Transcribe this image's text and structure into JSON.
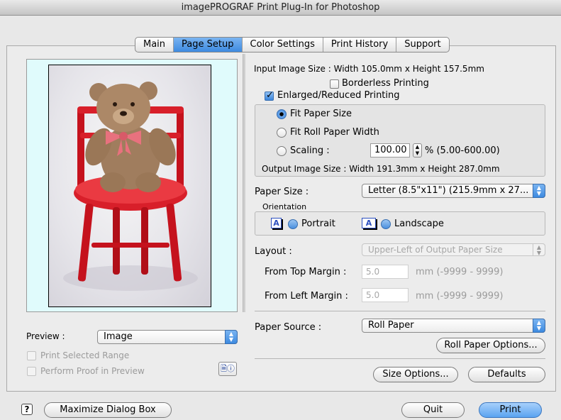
{
  "window": {
    "title": "imagePROGRAF Print Plug-In for Photoshop"
  },
  "tabs": [
    {
      "label": "Main",
      "active": false
    },
    {
      "label": "Page Setup",
      "active": true
    },
    {
      "label": "Color Settings",
      "active": false
    },
    {
      "label": "Print History",
      "active": false
    },
    {
      "label": "Support",
      "active": false
    }
  ],
  "page_setup": {
    "input_image_size": "Input Image Size : Width 105.0mm x Height 157.5mm",
    "borderless_printing": {
      "label": "Borderless Printing",
      "checked": false
    },
    "enlarged_reduced": {
      "label": "Enlarged/Reduced Printing",
      "checked": true
    },
    "fit_paper_size": {
      "label": "Fit Paper Size",
      "selected": true
    },
    "fit_roll_paper_width": {
      "label": "Fit Roll Paper Width",
      "selected": false
    },
    "scaling": {
      "label": "Scaling :",
      "selected": false,
      "value": "100.00",
      "range": "% (5.00-600.00)"
    },
    "output_image_size": "Output Image Size : Width 191.3mm x Height 287.0mm",
    "paper_size": {
      "label": "Paper Size :",
      "value": "Letter (8.5\"x11\") (215.9mm x 27..."
    },
    "orientation": {
      "label": "Orientation",
      "portrait": "Portrait",
      "landscape": "Landscape",
      "icon_glyph": "A"
    },
    "layout": {
      "label": "Layout :",
      "value": "Upper-Left of Output Paper Size"
    },
    "top_margin": {
      "label": "From Top Margin :",
      "value": "5.0",
      "range": "mm  (-9999 - 9999)"
    },
    "left_margin": {
      "label": "From Left Margin :",
      "value": "5.0",
      "range": "mm  (-9999 - 9999)"
    },
    "paper_source": {
      "label": "Paper Source :",
      "value": "Roll Paper"
    },
    "roll_paper_options": "Roll Paper Options...",
    "size_options": "Size Options...",
    "defaults": "Defaults"
  },
  "preview": {
    "label": "Preview :",
    "value": "Image",
    "print_selected_range": "Print Selected Range",
    "perform_proof": "Perform Proof in Preview",
    "background_color": "#e0fbfc"
  },
  "footer": {
    "help_glyph": "?",
    "maximize": "Maximize Dialog Box",
    "quit": "Quit",
    "print": "Print"
  },
  "colors": {
    "accent": "#3d8ae0",
    "chair_red": "#d81f2a",
    "bear_brown": "#a07d5e",
    "ribbon_pink": "#e8717e"
  }
}
